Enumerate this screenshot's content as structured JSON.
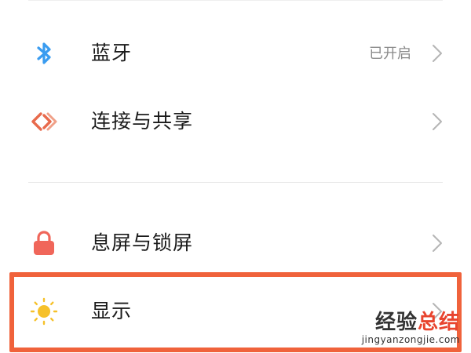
{
  "settings": {
    "items": [
      {
        "icon": "bluetooth-icon",
        "label": "蓝牙",
        "value": "已开启",
        "icon_color": "#3a9cf0"
      },
      {
        "icon": "connection-share-icon",
        "label": "连接与共享",
        "value": "",
        "icon_color": "#e86a4c"
      },
      {
        "icon": "lock-icon",
        "label": "息屏与锁屏",
        "value": "",
        "icon_color": "#f0665a"
      },
      {
        "icon": "sun-icon",
        "label": "显示",
        "value": "",
        "icon_color": "#f6c12a"
      }
    ],
    "highlighted_item": "显示"
  },
  "colors": {
    "highlight_border": "#f0623b",
    "label_text": "#1a1a1a",
    "value_text": "#8a8a8a",
    "chevron": "#b5b5b5"
  },
  "watermark": {
    "title_part1": "经验",
    "title_part2": "总结",
    "url": "jingyanzongjie.com"
  }
}
